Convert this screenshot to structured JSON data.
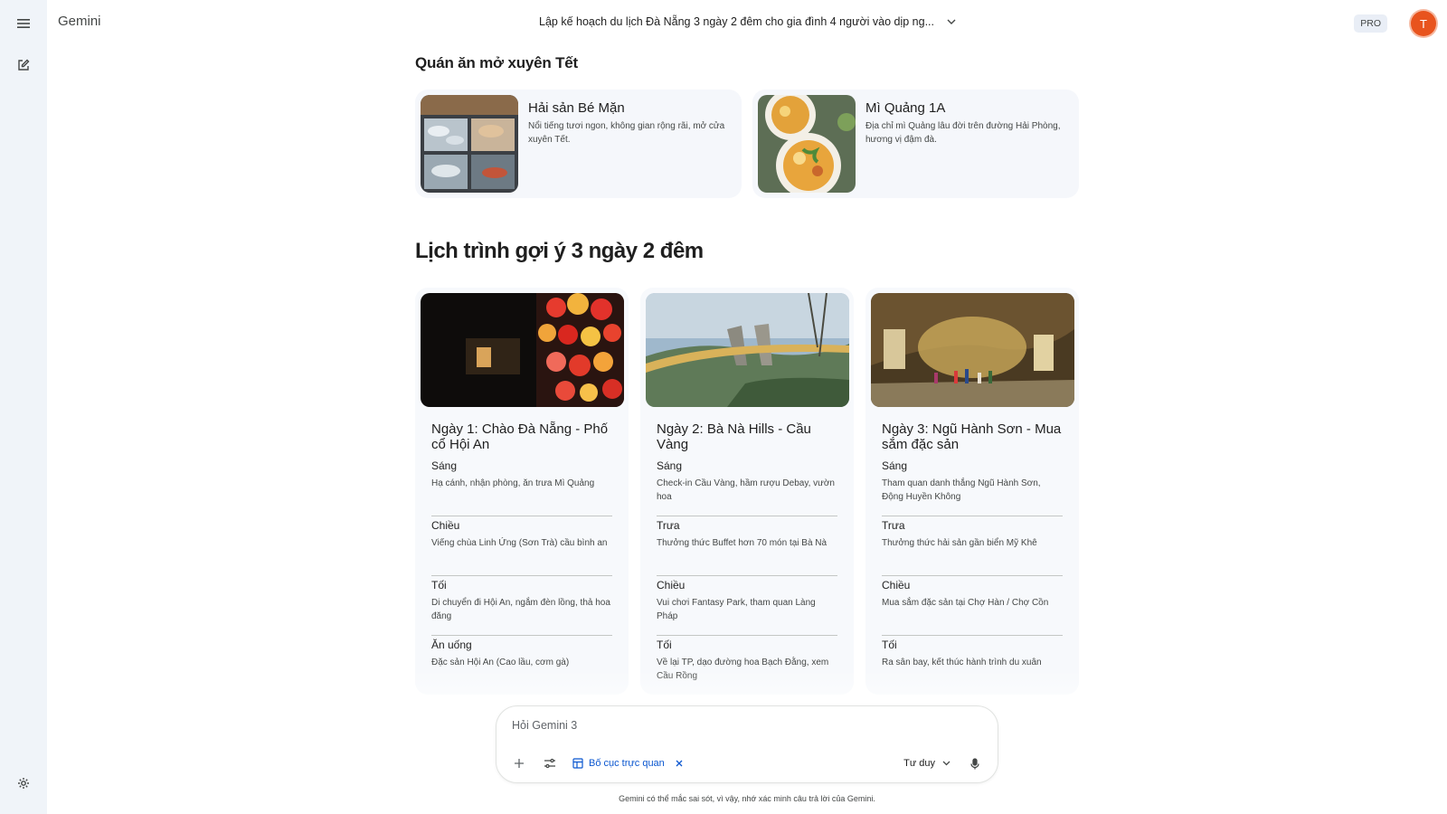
{
  "app": {
    "brand": "Gemini",
    "pro_label": "PRO",
    "avatar_initial": "T"
  },
  "conversation": {
    "title": "Lập kế hoạch du lịch Đà Nẵng 3 ngày 2 đêm cho gia đình 4 người vào dịp ng..."
  },
  "rail": {
    "icons": [
      "menu-icon",
      "new-chat-icon",
      "settings-icon"
    ]
  },
  "restaurants": {
    "heading": "Quán ăn mở xuyên Tết",
    "items": [
      {
        "name": "Hải sản Bé Mặn",
        "desc": "Nổi tiếng tươi ngon, không gian rộng rãi, mở cửa xuyên Tết."
      },
      {
        "name": "Mì Quảng 1A",
        "desc": "Địa chỉ mì Quảng lâu đời trên đường Hải Phòng, hương vị đậm đà."
      }
    ]
  },
  "itinerary": {
    "heading": "Lịch trình gợi ý 3 ngày 2 đêm",
    "days": [
      {
        "title": "Ngày 1: Chào Đà Nẵng - Phố cổ Hội An",
        "slots": [
          {
            "name": "Sáng",
            "text": "Hạ cánh, nhận phòng, ăn trưa Mì Quảng"
          },
          {
            "name": "Chiều",
            "text": "Viếng chùa Linh Ứng (Sơn Trà) cầu bình an"
          },
          {
            "name": "Tối",
            "text": "Di chuyển đi Hội An, ngắm đèn lồng, thả hoa đăng"
          },
          {
            "name": "Ăn uống",
            "text": "Đặc sản Hội An (Cao lầu, cơm gà)"
          }
        ]
      },
      {
        "title": "Ngày 2: Bà Nà Hills - Cầu Vàng",
        "slots": [
          {
            "name": "Sáng",
            "text": "Check-in Cầu Vàng, hầm rượu Debay, vườn hoa"
          },
          {
            "name": "Trưa",
            "text": "Thưởng thức Buffet hơn 70 món tại Bà Nà"
          },
          {
            "name": "Chiều",
            "text": "Vui chơi Fantasy Park, tham quan Làng Pháp"
          },
          {
            "name": "Tối",
            "text": "Về lại TP, dạo đường hoa Bạch Đằng, xem Cầu Rồng"
          }
        ]
      },
      {
        "title": "Ngày 3: Ngũ Hành Sơn - Mua sắm đặc sản",
        "slots": [
          {
            "name": "Sáng",
            "text": "Tham quan danh thắng Ngũ Hành Sơn, Động Huyền Không"
          },
          {
            "name": "Trưa",
            "text": "Thưởng thức hải sản gần biển Mỹ Khê"
          },
          {
            "name": "Chiều",
            "text": "Mua sắm đặc sản tại Chợ Hàn / Chợ Cồn"
          },
          {
            "name": "Tối",
            "text": "Ra sân bay, kết thúc hành trình du xuân"
          }
        ]
      }
    ]
  },
  "composer": {
    "placeholder": "Hỏi Gemini 3",
    "chip_label": "Bố cục trực quan",
    "mode_label": "Tư duy",
    "disclaimer": "Gemini có thể mắc sai sót, vì vậy, nhớ xác minh câu trả lời của Gemini."
  },
  "colors": {
    "rail_bg": "#f0f4f9",
    "accent": "#0b57d0",
    "avatar": "#e8541e"
  }
}
